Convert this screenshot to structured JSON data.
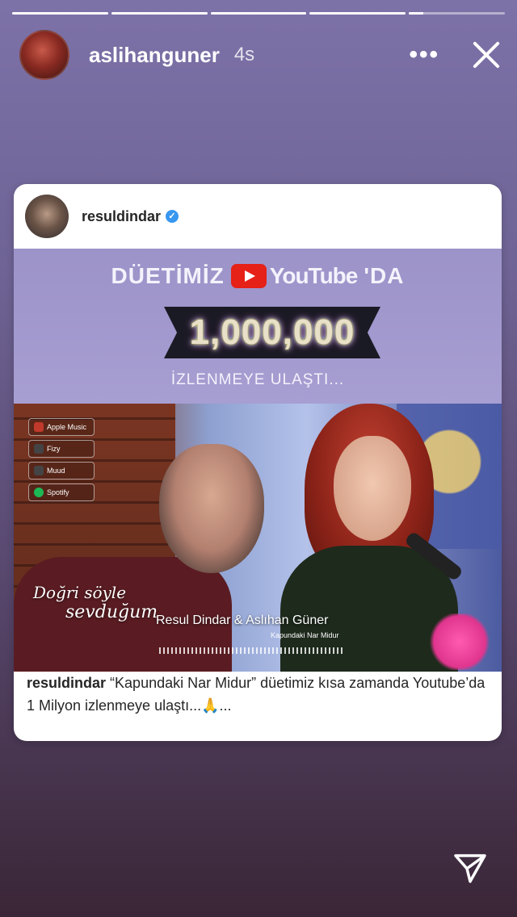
{
  "story": {
    "progress": [
      1,
      1,
      1,
      1,
      0.15
    ],
    "username": "aslihanguner",
    "time": "4s"
  },
  "icons": {
    "more": "more-horizontal-icon",
    "close": "close-icon",
    "verified": "verified-badge-icon",
    "send": "send-direct-icon",
    "youtube": "youtube-logo-icon"
  },
  "post": {
    "author": "resuldindar",
    "banner": {
      "prefix": "DÜETİMİZ",
      "youtube_word": "YouTube",
      "suffix": "'DA",
      "count": "1,000,000",
      "reached": "İZLENMEYE ULAŞTI..."
    },
    "streams": [
      "Apple Music",
      "Fizy",
      "Muud",
      "Spotify"
    ],
    "lyric_line1": "Doğri söyle",
    "lyric_line2": "sevduğum",
    "artists": "Resul Dindar & Aslıhan Güner",
    "song_small": "Kapundaki Nar Midur",
    "caption_user": "resuldindar",
    "caption_text": "“Kapundaki Nar Midur” düetimiz kısa zamanda Youtube’da 1 Milyon izlenmeye ulaştı...🙏..."
  },
  "colors": {
    "background_top": "#7d72a8",
    "background_bottom": "#3a2636",
    "banner": "#a39ad0",
    "verified": "#3897f0",
    "youtube_red": "#e62117"
  }
}
